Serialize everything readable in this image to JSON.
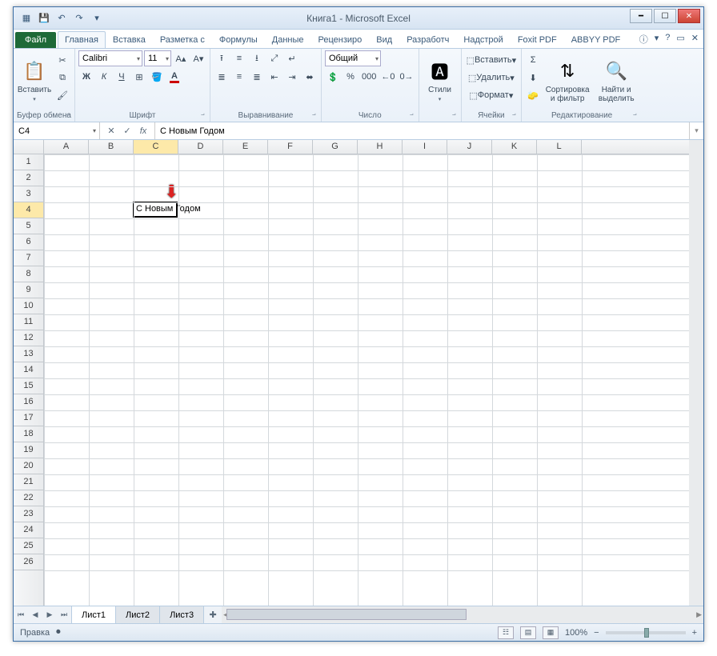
{
  "window": {
    "title": "Книга1 - Microsoft Excel"
  },
  "qat": {
    "save": "💾",
    "undo": "↶",
    "redo": "↷"
  },
  "tabs": {
    "file": "Файл",
    "items": [
      "Главная",
      "Вставка",
      "Разметка с",
      "Формулы",
      "Данные",
      "Рецензиро",
      "Вид",
      "Разработч",
      "Надстрой",
      "Foxit PDF",
      "ABBYY PDF"
    ],
    "activeIndex": 0
  },
  "ribbon": {
    "clipboard": {
      "label": "Буфер обмена",
      "paste": "Вставить"
    },
    "font": {
      "label": "Шрифт",
      "name": "Calibri",
      "size": "11",
      "bold": "Ж",
      "italic": "К",
      "underline": "Ч",
      "border": "⊞",
      "fill": "🪣",
      "color": "A"
    },
    "align": {
      "label": "Выравнивание",
      "wrap": "↵",
      "merge": "⬌"
    },
    "number": {
      "label": "Число",
      "format": "Общий",
      "currency": "💲",
      "percent": "%",
      "comma": "000",
      "inc": "←0",
      "dec": "0→"
    },
    "styles": {
      "label": "",
      "styles": "Стили"
    },
    "cells": {
      "label": "Ячейки",
      "insert": "Вставить",
      "delete": "Удалить",
      "format": "Формат"
    },
    "editing": {
      "label": "Редактирование",
      "sum": "Σ",
      "fill": "⬇",
      "clear": "🧽",
      "sort": "Сортировка и фильтр",
      "find": "Найти и выделить"
    }
  },
  "formula": {
    "namebox": "C4",
    "cancel": "✕",
    "enter": "✓",
    "fx": "fx",
    "value": "С Новым Годом"
  },
  "grid": {
    "cols": [
      "A",
      "B",
      "C",
      "D",
      "E",
      "F",
      "G",
      "H",
      "I",
      "J",
      "K",
      "L"
    ],
    "rowCount": 26,
    "active": {
      "col": 2,
      "row": 3,
      "text": "С Новым Годом"
    }
  },
  "sheets": {
    "items": [
      "Лист1",
      "Лист2",
      "Лист3"
    ],
    "activeIndex": 0
  },
  "status": {
    "mode": "Правка",
    "zoom": "100%"
  }
}
